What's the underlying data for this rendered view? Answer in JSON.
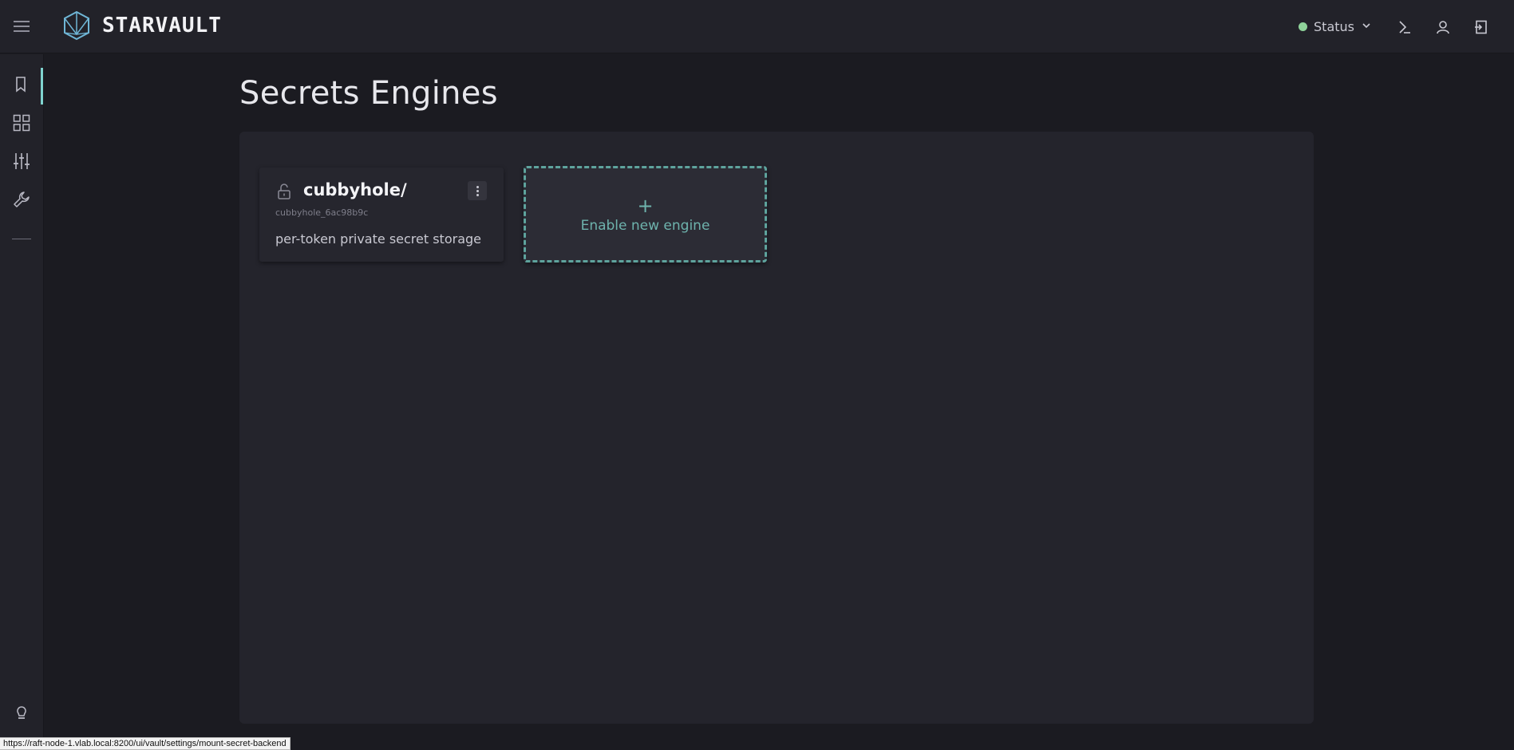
{
  "app": {
    "brand": "STARVAULT"
  },
  "header": {
    "status_label": "Status",
    "status_color": "#8fd39a",
    "icons": [
      "menu-icon",
      "console-icon",
      "user-icon",
      "logout-icon"
    ]
  },
  "sidebar": {
    "items": [
      {
        "name": "secrets",
        "icon": "bookmark-icon",
        "active": true
      },
      {
        "name": "dashboard",
        "icon": "grid-icon",
        "active": false
      },
      {
        "name": "settings",
        "icon": "sliders-icon",
        "active": false
      },
      {
        "name": "tools",
        "icon": "wrench-icon",
        "active": false
      }
    ],
    "bottom_icon": "lightbulb-icon"
  },
  "main": {
    "title": "Secrets Engines",
    "engines": [
      {
        "path": "cubbyhole/",
        "accessor": "cubbyhole_6ac98b9c",
        "description": "per-token private secret storage",
        "icon": "unlock-icon"
      }
    ],
    "enable_new": {
      "plus": "+",
      "label": "Enable new engine"
    }
  },
  "accent_color": "#5ea39d",
  "status_url": "https://raft-node-1.vlab.local:8200/ui/vault/settings/mount-secret-backend"
}
